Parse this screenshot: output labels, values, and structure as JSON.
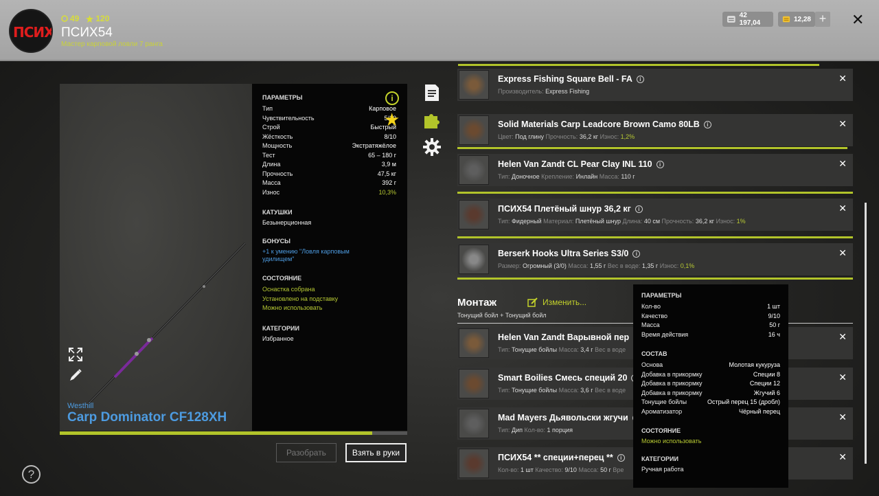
{
  "header": {
    "avatar_text": "ПСИХ",
    "coins": "49",
    "stars": "120",
    "player_name": "ПСИХ54",
    "player_rank": "Мастер карповой ловли 7 ранга",
    "silver": "42 197,04",
    "gold": "12,28",
    "plus": "+",
    "close": "✕"
  },
  "rod": {
    "maker": "Westhill",
    "name": "Carp Dominator CF128XH",
    "progress": 0.9,
    "params_title": "ПАРАМЕТРЫ",
    "params": [
      {
        "k": "Тип",
        "v": "Карповое"
      },
      {
        "k": "Чувствительность",
        "v": "5/10"
      },
      {
        "k": "Строй",
        "v": "Быстрый"
      },
      {
        "k": "Жёсткость",
        "v": "8/10"
      },
      {
        "k": "Мощность",
        "v": "Экстратяжёлое"
      },
      {
        "k": "Тест",
        "v": "65 – 180 г"
      },
      {
        "k": "Длина",
        "v": "3,9 м"
      },
      {
        "k": "Прочность",
        "v": "47,5 кг"
      },
      {
        "k": "Масса",
        "v": "392 г"
      },
      {
        "k": "Износ",
        "v": "10,3%"
      }
    ],
    "reels_title": "КАТУШКИ",
    "reels_value": "Безынерционная",
    "bonus_title": "БОНУСЫ",
    "bonus_value": "+1 к умению \"Ловля карповым удилищем\"",
    "state_title": "СОСТОЯНИЕ",
    "state_lines": [
      "Оснастка собрана",
      "Установлено на подставку",
      "Можно использовать"
    ],
    "cat_title": "КАТЕГОРИИ",
    "cat_value": "Избранное",
    "info": "i",
    "star": "★",
    "btn_disassemble": "Разобрать",
    "btn_take": "Взять в руки"
  },
  "help": "?",
  "tackle": [
    {
      "name": "Express Fishing Square Bell - FA",
      "desc": [
        [
          "Производитель: ",
          "Express Fishing"
        ]
      ]
    },
    {
      "name": "Solid Materials Carp Leadcore Brown Camo 80LB",
      "desc": [
        [
          "Цвет: ",
          "Под глину"
        ],
        [
          " Прочность: ",
          "36,2 кг"
        ],
        [
          " Износ: ",
          "1,2%"
        ]
      ]
    },
    {
      "name": "Helen Van Zandt CL Pear Clay INL 110",
      "desc": [
        [
          "Тип: ",
          "Доночное"
        ],
        [
          " Крепление: ",
          "Инлайн"
        ],
        [
          " Масса: ",
          "110 г"
        ]
      ]
    },
    {
      "name": "ПСИХ54 Плетёный шнур 36,2 кг",
      "desc": [
        [
          "Тип: ",
          "Фидерный"
        ],
        [
          " Материал: ",
          "Плетёный шнур"
        ],
        [
          " Длина: ",
          "40 см"
        ],
        [
          " Прочность: ",
          "36,2 кг"
        ],
        [
          " Износ: ",
          "1%"
        ]
      ]
    },
    {
      "name": "Berserk Hooks Ultra Series S3/0",
      "desc": [
        [
          "Размер: ",
          "Огромный (3/0)"
        ],
        [
          " Масса: ",
          "1,55 г"
        ],
        [
          " Вес в воде: ",
          "1,35 г"
        ],
        [
          " Износ: ",
          "0,1%"
        ]
      ]
    }
  ],
  "montage": {
    "title": "Монтаж",
    "edit": "Изменить...",
    "sub": "Тонущий бойл + Тонущий бойл",
    "items": [
      {
        "name": "Helen Van Zandt Варывной пер",
        "desc": [
          [
            "Тип: ",
            "Тонущие бойлы"
          ],
          [
            " Масса: ",
            "3,4 г"
          ],
          [
            " Вес в воде",
            ""
          ]
        ]
      },
      {
        "name": "Smart Boilies Смесь специй 20",
        "desc": [
          [
            "Тип: ",
            "Тонущие бойлы"
          ],
          [
            " Масса: ",
            "3,6 г"
          ],
          [
            " Вес в воде",
            ""
          ]
        ]
      },
      {
        "name": "Mad Mayers Дьявольски жгучи",
        "desc": [
          [
            "Тип: ",
            "Дип"
          ],
          [
            " Кол-во: ",
            "1 порция"
          ]
        ]
      },
      {
        "name": "ПСИХ54 ** специи+перец **",
        "desc": [
          [
            "Кол-во: ",
            "1 шт"
          ],
          [
            " Качество: ",
            "9/10"
          ],
          [
            " Масса: ",
            "50 г"
          ],
          [
            " Вре",
            ""
          ]
        ]
      }
    ]
  },
  "tooltip": {
    "params_title": "ПАРАМЕТРЫ",
    "params": [
      {
        "k": "Кол-во",
        "v": "1 шт"
      },
      {
        "k": "Качество",
        "v": "9/10"
      },
      {
        "k": "Масса",
        "v": "50 г"
      },
      {
        "k": "Время действия",
        "v": "16 ч"
      }
    ],
    "comp_title": "СОСТАВ",
    "comp": [
      {
        "k": "Основа",
        "v": "Молотая кукуруза"
      },
      {
        "k": "Добавка в прикормку",
        "v": "Специи 8"
      },
      {
        "k": "Добавка в прикормку",
        "v": "Специи 12"
      },
      {
        "k": "Добавка в прикормку",
        "v": "Жгучий 6"
      },
      {
        "k": "Тонущие бойлы",
        "v": "Острый перец 15 (дробл)"
      },
      {
        "k": "Ароматизатор",
        "v": "Чёрный перец"
      }
    ],
    "state_title": "СОСТОЯНИЕ",
    "state_value": "Можно использовать",
    "cat_title": "КАТЕГОРИИ",
    "cat_value": "Ручная работа"
  },
  "icons": {
    "close": "close-icon",
    "info": "info-icon",
    "favorite": "star-icon",
    "notes": "document-icon",
    "puzzle": "puzzle-icon",
    "settings": "gear-icon",
    "edit": "pencil-icon",
    "expand": "expand-icon",
    "help": "help-icon"
  },
  "colors": {
    "accent": "#b2c42a",
    "link": "#4d9be0",
    "star": "#f2d21a"
  }
}
